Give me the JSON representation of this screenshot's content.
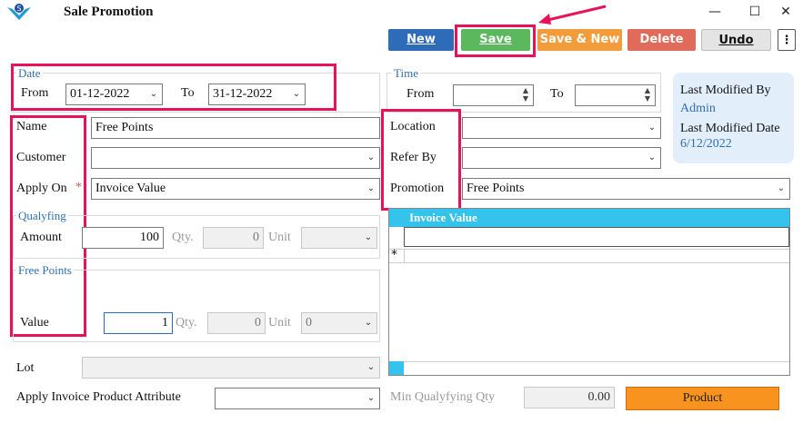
{
  "window": {
    "title": "Sale Promotion",
    "minimize": "—",
    "maximize": "☐",
    "close": "✕"
  },
  "toolbar": {
    "new_label": "New",
    "save_label": "Save",
    "save_new_label": "Save & New",
    "delete_label": "Delete",
    "undo_label": "Undo",
    "more_label": "⋮"
  },
  "date": {
    "group_title": "Date",
    "from_label": "From",
    "from_value": "01-12-2022",
    "to_label": "To",
    "to_value": "31-12-2022"
  },
  "time": {
    "group_title": "Time",
    "from_label": "From",
    "to_label": "To"
  },
  "modified": {
    "by_label": "Last Modified By",
    "by_value": "Admin",
    "date_label": "Last Modified Date",
    "date_value": "6/12/2022"
  },
  "form": {
    "name_label": "Name",
    "name_value": "Free Points",
    "customer_label": "Customer",
    "apply_on_label": "Apply On",
    "required_mark": "*",
    "apply_on_value": "Invoice Value",
    "location_label": "Location",
    "refer_by_label": "Refer By",
    "promotion_label": "Promotion",
    "promotion_value": "Free Points"
  },
  "qualifying": {
    "group_title": "Qualyfing",
    "amount_label": "Amount",
    "amount_value": "100",
    "qty_label": "Qty.",
    "qty_value": "0",
    "unit_label": "Unit"
  },
  "free_points": {
    "group_title": "Free Points",
    "value_label": "Value",
    "value_value": "1",
    "qty_label": "Qty.",
    "qty_value": "0",
    "unit_label": "Unit",
    "unit_value": "0"
  },
  "grid": {
    "header": "Invoice Value",
    "new_row_marker": "*"
  },
  "bottom": {
    "lot_label": "Lot",
    "attr_label": "Apply Invoice Product Attribute",
    "min_qty_label": "Min Qualyfying Qty",
    "min_qty_value": "0.00",
    "product_label": "Product"
  },
  "colors": {
    "new_btn": "#2e6bb8",
    "save_btn": "#5cb85c",
    "save_new_btn": "#f39c3b",
    "delete_btn": "#e06b5b",
    "highlight": "#e8125c",
    "grid_header": "#33c3ec",
    "product_btn": "#f7931e"
  }
}
